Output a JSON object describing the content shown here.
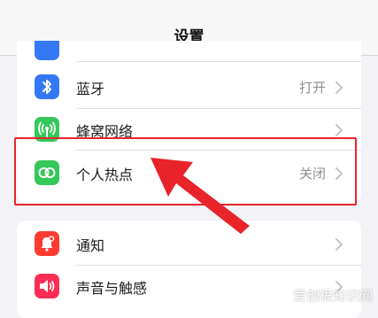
{
  "header": {
    "title": "设置"
  },
  "group_1": {
    "items": [
      {
        "label": "蓝牙",
        "value": "打开",
        "icon": "bluetooth-icon",
        "color": "#3478f6"
      },
      {
        "label": "蜂窝网络",
        "value": "",
        "icon": "cellular-icon",
        "color": "#34c759"
      },
      {
        "label": "个人热点",
        "value": "关闭",
        "icon": "personal-hotspot-icon",
        "color": "#34c759"
      }
    ]
  },
  "group_2": {
    "items": [
      {
        "label": "通知",
        "value": "",
        "icon": "notifications-icon",
        "color": "#ff3b30"
      },
      {
        "label": "声音与触感",
        "value": "",
        "icon": "sounds-haptics-icon",
        "color": "#ff2d55"
      }
    ]
  },
  "annotation": {
    "highlight_color": "#e8242a"
  },
  "watermark": {
    "text": "爱创根知识网"
  }
}
